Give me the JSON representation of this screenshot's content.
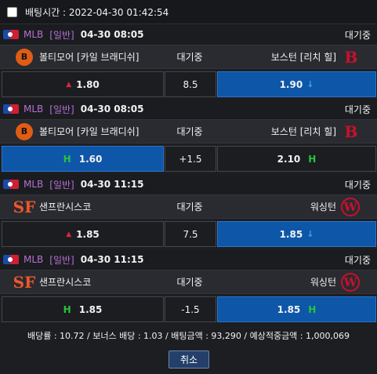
{
  "header": {
    "label": "배팅시간 : 2022-04-30 01:42:54"
  },
  "games": [
    {
      "league": "MLB",
      "type": "[일반]",
      "time": "04-30 08:05",
      "status": "대기중",
      "home": "볼티모어 [카일 브래디쉬]",
      "mid": "대기중",
      "away": "보스턴 [리치 힐]",
      "home_logo": "B",
      "away_logo": "B",
      "odds_home": "1.80",
      "odds_mid": "8.5",
      "odds_away": "1.90",
      "marker_home": "▲",
      "marker_away": "↓"
    },
    {
      "league": "MLB",
      "type": "[일반]",
      "time": "04-30 08:05",
      "status": "대기중",
      "home": "볼티모어 [카일 브래디쉬]",
      "mid": "대기중",
      "away": "보스턴 [리치 힐]",
      "home_logo": "B",
      "away_logo": "B",
      "odds_home": "1.60",
      "odds_mid": "+1.5",
      "odds_away": "2.10",
      "marker_home": "H",
      "marker_away": "H"
    },
    {
      "league": "MLB",
      "type": "[일반]",
      "time": "04-30 11:15",
      "status": "대기중",
      "home": "샌프란시스코",
      "mid": "대기중",
      "away": "워싱턴",
      "home_logo": "SF",
      "away_logo": "W",
      "odds_home": "1.85",
      "odds_mid": "7.5",
      "odds_away": "1.85",
      "marker_home": "▲",
      "marker_away": "↓"
    },
    {
      "league": "MLB",
      "type": "[일반]",
      "time": "04-30 11:15",
      "status": "대기중",
      "home": "샌프란시스코",
      "mid": "대기중",
      "away": "워싱턴",
      "home_logo": "SF",
      "away_logo": "W",
      "odds_home": "1.85",
      "odds_mid": "-1.5",
      "odds_away": "1.85",
      "marker_home": "H",
      "marker_away": "H"
    }
  ],
  "summary": "배당률 : 10.72 / 보너스 배당 : 1.03 / 배팅금액 : 93,290 / 예상적중금액 : 1,000,069",
  "cancel_label": "취소",
  "colors": {
    "selected": "#0e56a8",
    "up": "#e0243a",
    "down": "#3aa3ff",
    "handicap": "#27c43a",
    "league": "#b66fd3"
  }
}
